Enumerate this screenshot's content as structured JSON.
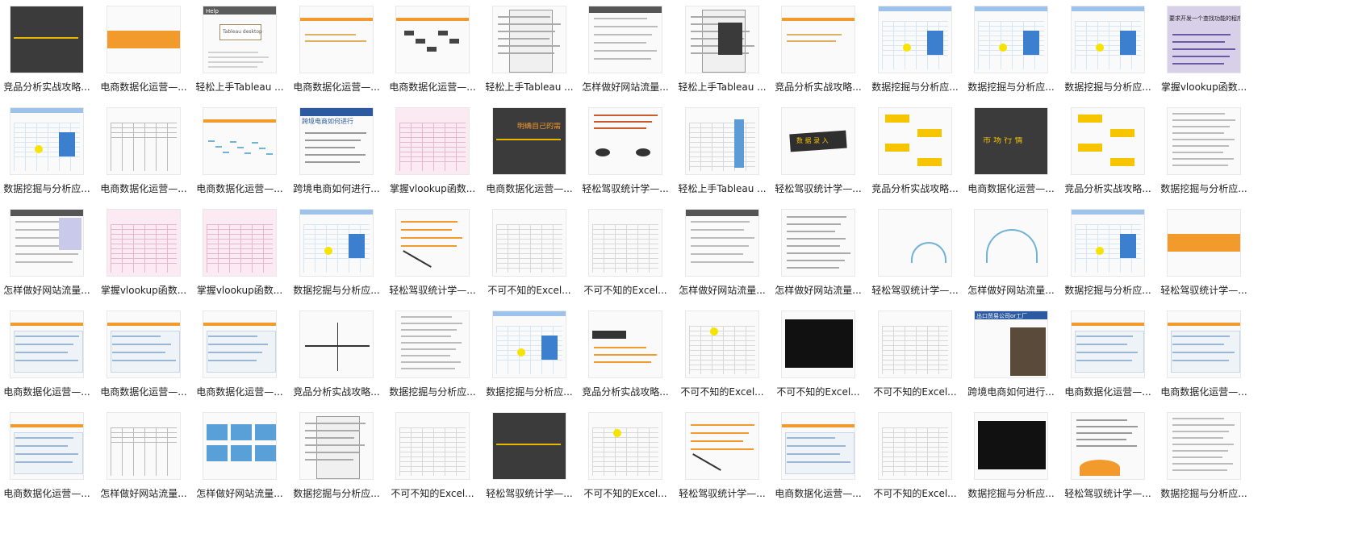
{
  "thumb_texts": {
    "tableau_box": "Tableau desktop",
    "icon_label": "Help",
    "shop_title": "跨境电商如何进行",
    "factory_title": "出口贸易公司or工厂",
    "vlookup_title": "要求开发一个查找功能的程序",
    "market_text": "市 场 行 情",
    "search_text": "数 据 录 入",
    "summary_text": "明确自己的需"
  },
  "tiles": [
    {
      "label": "竞品分析实战攻略...",
      "theme": "dark"
    },
    {
      "label": "电商数据化运营—...",
      "theme": "orange"
    },
    {
      "label": "轻松上手Tableau ...",
      "theme": "tableau"
    },
    {
      "label": "电商数据化运营—...",
      "theme": "light"
    },
    {
      "label": "电商数据化运营—...",
      "theme": "map"
    },
    {
      "label": "轻松上手Tableau ...",
      "theme": "ui"
    },
    {
      "label": "怎样做好网站流量...",
      "theme": "web"
    },
    {
      "label": "轻松上手Tableau ...",
      "theme": "dialog"
    },
    {
      "label": "竞品分析实战攻略...",
      "theme": "light2"
    },
    {
      "label": "数据挖掘与分析应...",
      "theme": "spss"
    },
    {
      "label": "数据挖掘与分析应...",
      "theme": "spss2"
    },
    {
      "label": "数据挖掘与分析应...",
      "theme": "spss"
    },
    {
      "label": "掌握vlookup函数...",
      "theme": "vlookup"
    },
    {
      "label": "数据挖掘与分析应...",
      "theme": "spss2"
    },
    {
      "label": "电商数据化运营—...",
      "theme": "table"
    },
    {
      "label": "电商数据化运营—...",
      "theme": "linechart"
    },
    {
      "label": "跨境电商如何进行...",
      "theme": "shop"
    },
    {
      "label": "掌握vlookup函数...",
      "theme": "sheet_pink"
    },
    {
      "label": "电商数据化运营—...",
      "theme": "dark2"
    },
    {
      "label": "轻松驾驭统计学—...",
      "theme": "ellipse"
    },
    {
      "label": "轻松上手Tableau ...",
      "theme": "grid_blue"
    },
    {
      "label": "轻松驾驭统计学—...",
      "theme": "search"
    },
    {
      "label": "竞品分析实战攻略...",
      "theme": "tags"
    },
    {
      "label": "电商数据化运营—...",
      "theme": "market"
    },
    {
      "label": "竞品分析实战攻略...",
      "theme": "flow"
    },
    {
      "label": "数据挖掘与分析应...",
      "theme": "doc"
    },
    {
      "label": "怎样做好网站流量...",
      "theme": "web2"
    },
    {
      "label": "掌握vlookup函数...",
      "theme": "vlookup2"
    },
    {
      "label": "掌握vlookup函数...",
      "theme": "sheet_pink"
    },
    {
      "label": "数据挖掘与分析应...",
      "theme": "spss3"
    },
    {
      "label": "轻松驾驭统计学—...",
      "theme": "stats"
    },
    {
      "label": "不可不知的Excel...",
      "theme": "excel"
    },
    {
      "label": "不可不知的Excel...",
      "theme": "excel2"
    },
    {
      "label": "怎样做好网站流量...",
      "theme": "web3"
    },
    {
      "label": "怎样做好网站流量...",
      "theme": "form"
    },
    {
      "label": "轻松驾驭统计学—...",
      "theme": "curve"
    },
    {
      "label": "怎样做好网站流量...",
      "theme": "bell"
    },
    {
      "label": "数据挖掘与分析应...",
      "theme": "spss4"
    },
    {
      "label": "轻松驾驭统计学—...",
      "theme": "orange2"
    },
    {
      "label": "电商数据化运营—...",
      "theme": "dash"
    },
    {
      "label": "电商数据化运营—...",
      "theme": "dash2"
    },
    {
      "label": "电商数据化运营—...",
      "theme": "dash3"
    },
    {
      "label": "竞品分析实战攻略...",
      "theme": "quadrant"
    },
    {
      "label": "数据挖掘与分析应...",
      "theme": "textdoc"
    },
    {
      "label": "数据挖掘与分析应...",
      "theme": "spss5"
    },
    {
      "label": "竞品分析实战攻略...",
      "theme": "bannerdoc"
    },
    {
      "label": "不可不知的Excel...",
      "theme": "excel3"
    },
    {
      "label": "不可不知的Excel...",
      "theme": "excel_dark"
    },
    {
      "label": "不可不知的Excel...",
      "theme": "excel4"
    },
    {
      "label": "跨境电商如何进行...",
      "theme": "factory"
    },
    {
      "label": "电商数据化运营—...",
      "theme": "dash4"
    },
    {
      "label": "电商数据化运营—...",
      "theme": "dash5"
    },
    {
      "label": "电商数据化运营—...",
      "theme": "dash6"
    },
    {
      "label": "怎样做好网站流量...",
      "theme": "table2"
    },
    {
      "label": "怎样做好网站流量...",
      "theme": "cards"
    },
    {
      "label": "数据挖掘与分析应...",
      "theme": "dialog2"
    },
    {
      "label": "不可不知的Excel...",
      "theme": "excel5"
    },
    {
      "label": "轻松驾驭统计学—...",
      "theme": "dark3"
    },
    {
      "label": "不可不知的Excel...",
      "theme": "excel6"
    },
    {
      "label": "轻松驾驭统计学—...",
      "theme": "stats2"
    },
    {
      "label": "电商数据化运营—...",
      "theme": "dash7"
    },
    {
      "label": "不可不知的Excel...",
      "theme": "excel7"
    },
    {
      "label": "数据挖掘与分析应...",
      "theme": "excel_dark2"
    },
    {
      "label": "轻松驾驭统计学—...",
      "theme": "summary"
    },
    {
      "label": "数据挖掘与分析应...",
      "theme": "textdoc2"
    }
  ]
}
